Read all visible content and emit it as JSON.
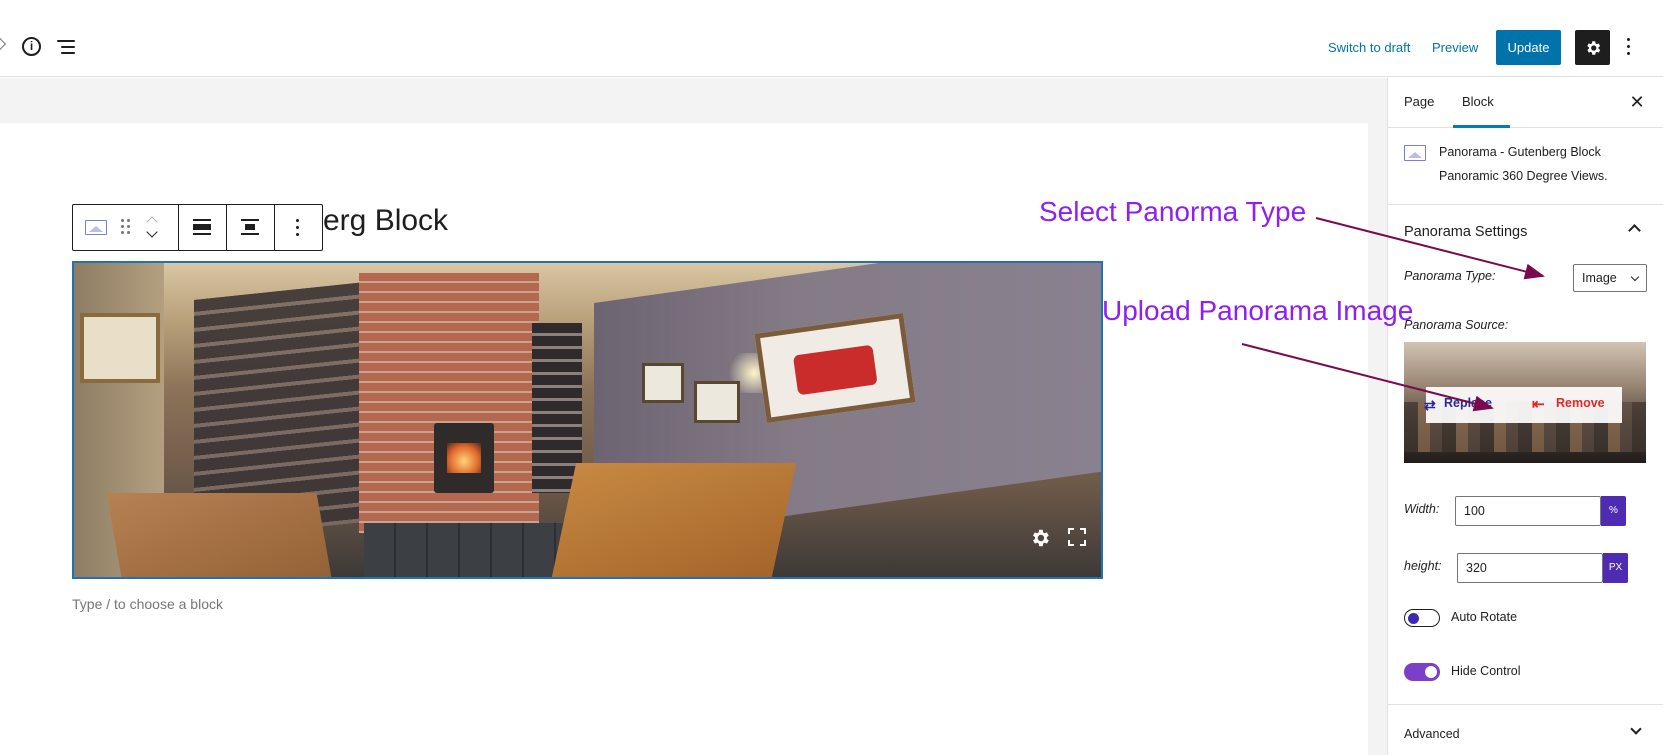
{
  "topbar": {
    "switch_to_draft": "Switch to draft",
    "preview": "Preview",
    "update": "Update",
    "info_glyph": "i",
    "icons": [
      "undo-icon",
      "info-icon",
      "list-view-icon",
      "settings-gear-icon",
      "more-options-icon"
    ]
  },
  "editor": {
    "title_visible": "erg Block",
    "appender_placeholder": "Type / to choose a block"
  },
  "sidebar": {
    "tabs": [
      {
        "label": "Page"
      },
      {
        "label": "Block",
        "active": true
      }
    ],
    "close_glyph": "✕",
    "block_card": {
      "title": "Panorama - Gutenberg Block",
      "description": "Panoramic 360 Degree Views."
    },
    "panel": {
      "title": "Panorama Settings",
      "type_label": "Panorama Type:",
      "type_value": "Image",
      "source_label": "Panorama Source:",
      "replace_label": "Replace",
      "remove_label": "Remove",
      "width_label": "Width:",
      "width_value": "100",
      "width_unit": "%",
      "height_label": "height:",
      "height_value": "320",
      "height_unit": "PX",
      "auto_rotate_label": "Auto Rotate",
      "auto_rotate_on": false,
      "hide_control_label": "Hide Control",
      "hide_control_on": true
    },
    "advanced_label": "Advanced"
  },
  "annotations": {
    "select_type": "Select Panorma Type",
    "upload_image": "Upload Panorama Image",
    "color": "#8f1ff0",
    "arrow_color": "#7a0a4e"
  },
  "colors": {
    "accent": "#0073aa",
    "toggle_on": "#7b3fc9",
    "unit_badge": "#4f2ab3",
    "remove": "#e22828"
  }
}
